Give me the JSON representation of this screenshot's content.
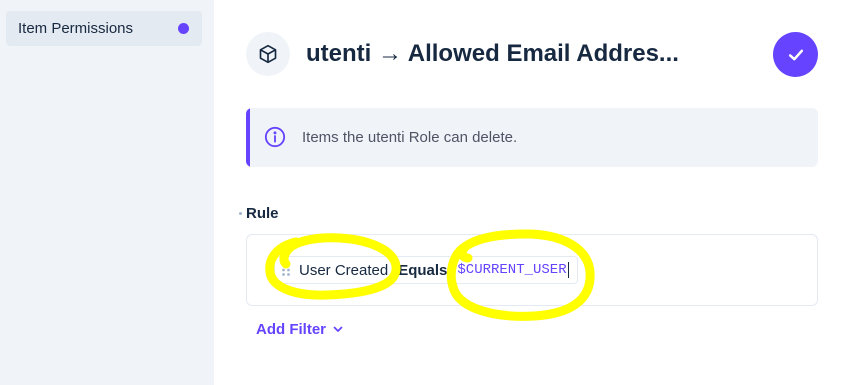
{
  "sidebar": {
    "items": [
      {
        "label": "Item Permissions",
        "active": true
      }
    ]
  },
  "header": {
    "title": "utenti → Allowed Email Addres...",
    "icon": "cube-icon",
    "save_icon": "check-icon"
  },
  "notice": {
    "icon": "info-icon",
    "text": "Items the utenti Role can delete."
  },
  "rule": {
    "label": "Rule",
    "filter": {
      "field": "User Created",
      "operator": "Equals",
      "value": "$CURRENT_USER"
    },
    "add_filter_label": "Add Filter"
  },
  "colors": {
    "accent": "#6644ff",
    "sidebar_bg": "#f0f4f9",
    "highlight": "#ffff00"
  }
}
